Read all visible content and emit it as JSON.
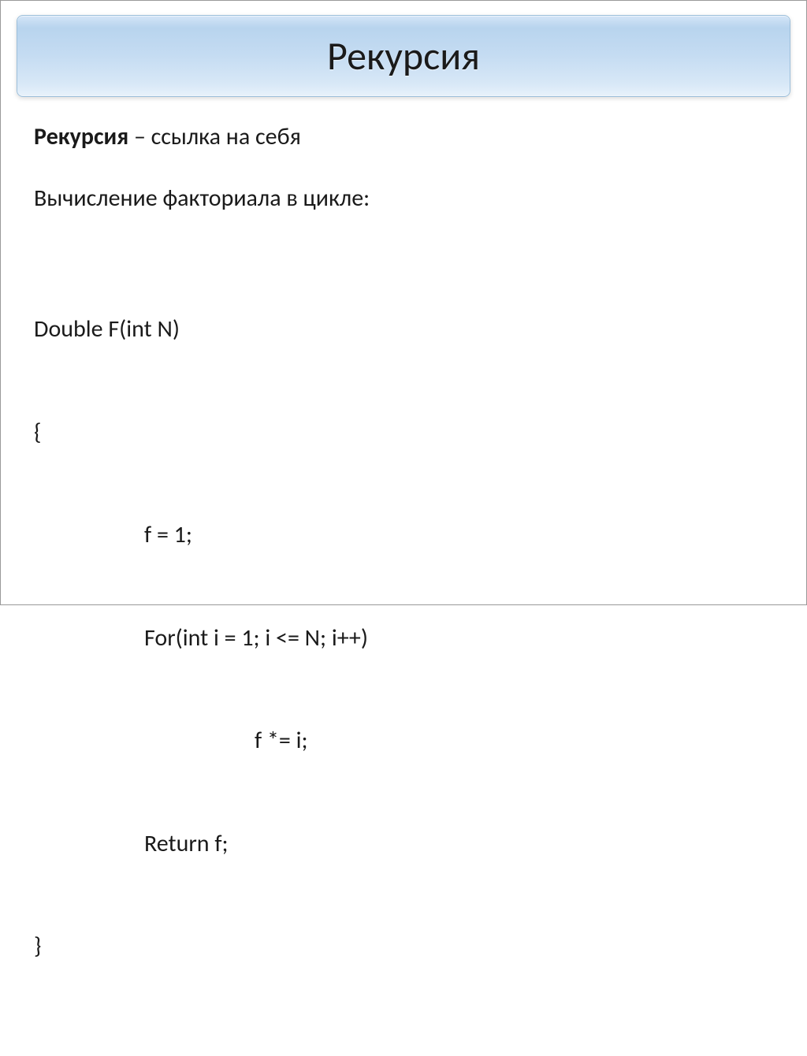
{
  "slide": {
    "title": "Рекурсия",
    "definition": {
      "term": "Рекурсия",
      "separator": " – ",
      "meaning": "ссылка на себя"
    },
    "description": "Вычисление факториала в цикле:",
    "code": {
      "line1": "Double F(int N)",
      "line2": "{",
      "line3": "f = 1;",
      "line4": "For(int i = 1; i <= N; i++)",
      "line5": "f *= i;",
      "line6": "Return f;",
      "line7": "}"
    }
  }
}
